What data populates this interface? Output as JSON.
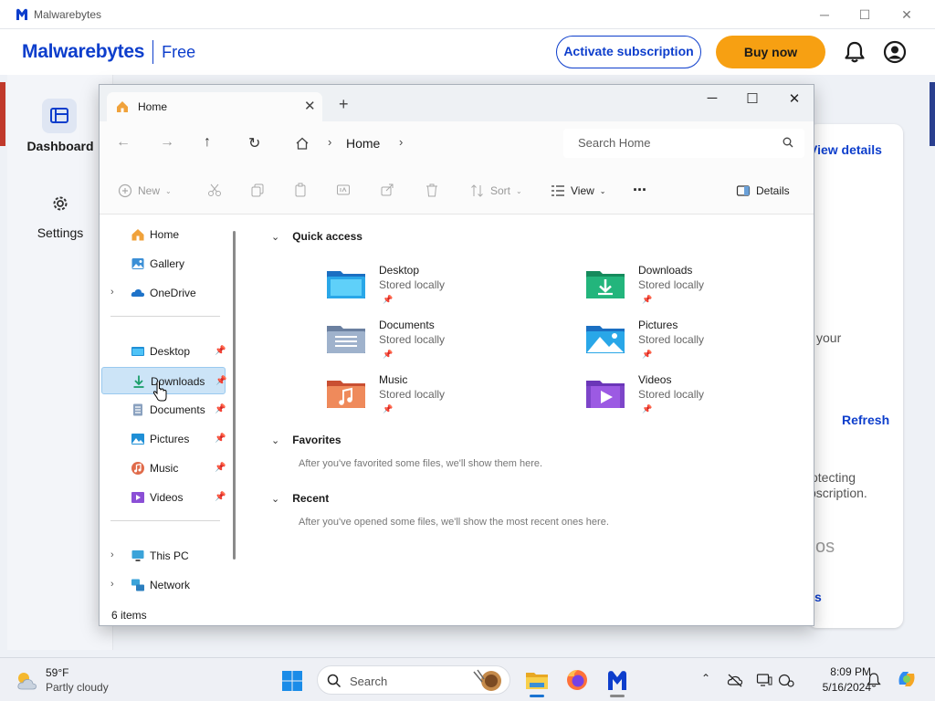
{
  "malwarebytes": {
    "window_title": "Malwarebytes",
    "brand": "Malwarebytes",
    "edition": "Free",
    "activate_label": "Activate subscription",
    "buy_label": "Buy now",
    "nav": [
      {
        "label": "Dashboard",
        "icon": "dashboard-icon"
      },
      {
        "label": "Settings",
        "icon": "gear-icon"
      }
    ],
    "background": {
      "view_details": "View details",
      "your": "your",
      "refresh": "Refresh",
      "protecting_1": "otecting",
      "protecting_2": "bscription.",
      "os": "os",
      "s": "s"
    },
    "colors": {
      "accent": "#0d3ecc",
      "buy": "#f7a012"
    }
  },
  "explorer": {
    "tab_title": "Home",
    "breadcrumb": "Home",
    "search_placeholder": "Search Home",
    "commands": {
      "new": "New",
      "sort": "Sort",
      "view": "View",
      "more": "...",
      "details": "Details"
    },
    "nav_pane": [
      {
        "label": "Home",
        "icon": "home-icon"
      },
      {
        "label": "Gallery",
        "icon": "gallery-icon"
      },
      {
        "label": "OneDrive",
        "icon": "onedrive-icon",
        "expandable": true
      },
      {
        "label": "Desktop",
        "icon": "desktop-folder-icon",
        "pinned": true
      },
      {
        "label": "Downloads",
        "icon": "downloads-folder-icon",
        "pinned": true,
        "selected": true
      },
      {
        "label": "Documents",
        "icon": "documents-folder-icon",
        "pinned": true
      },
      {
        "label": "Pictures",
        "icon": "pictures-folder-icon",
        "pinned": true
      },
      {
        "label": "Music",
        "icon": "music-folder-icon",
        "pinned": true
      },
      {
        "label": "Videos",
        "icon": "videos-folder-icon",
        "pinned": true
      },
      {
        "label": "This PC",
        "icon": "this-pc-icon",
        "expandable": true
      },
      {
        "label": "Network",
        "icon": "network-icon",
        "expandable": true
      }
    ],
    "sections": {
      "quick_access": "Quick access",
      "favorites": "Favorites",
      "favorites_note": "After you've favorited some files, we'll show them here.",
      "recent": "Recent",
      "recent_note": "After you've opened some files, we'll show the most recent ones here."
    },
    "quick_access": [
      {
        "name": "Desktop",
        "status": "Stored locally",
        "icon": "desktop-folder-icon"
      },
      {
        "name": "Downloads",
        "status": "Stored locally",
        "icon": "downloads-folder-icon"
      },
      {
        "name": "Documents",
        "status": "Stored locally",
        "icon": "documents-folder-icon"
      },
      {
        "name": "Pictures",
        "status": "Stored locally",
        "icon": "pictures-folder-icon"
      },
      {
        "name": "Music",
        "status": "Stored locally",
        "icon": "music-folder-icon"
      },
      {
        "name": "Videos",
        "status": "Stored locally",
        "icon": "videos-folder-icon"
      }
    ],
    "status_bar": "6 items"
  },
  "taskbar": {
    "temperature": "59°F",
    "condition": "Partly cloudy",
    "search_placeholder": "Search",
    "time": "8:09 PM",
    "date": "5/16/2024",
    "apps": [
      "file-explorer-icon",
      "firefox-icon",
      "malwarebytes-icon"
    ]
  }
}
